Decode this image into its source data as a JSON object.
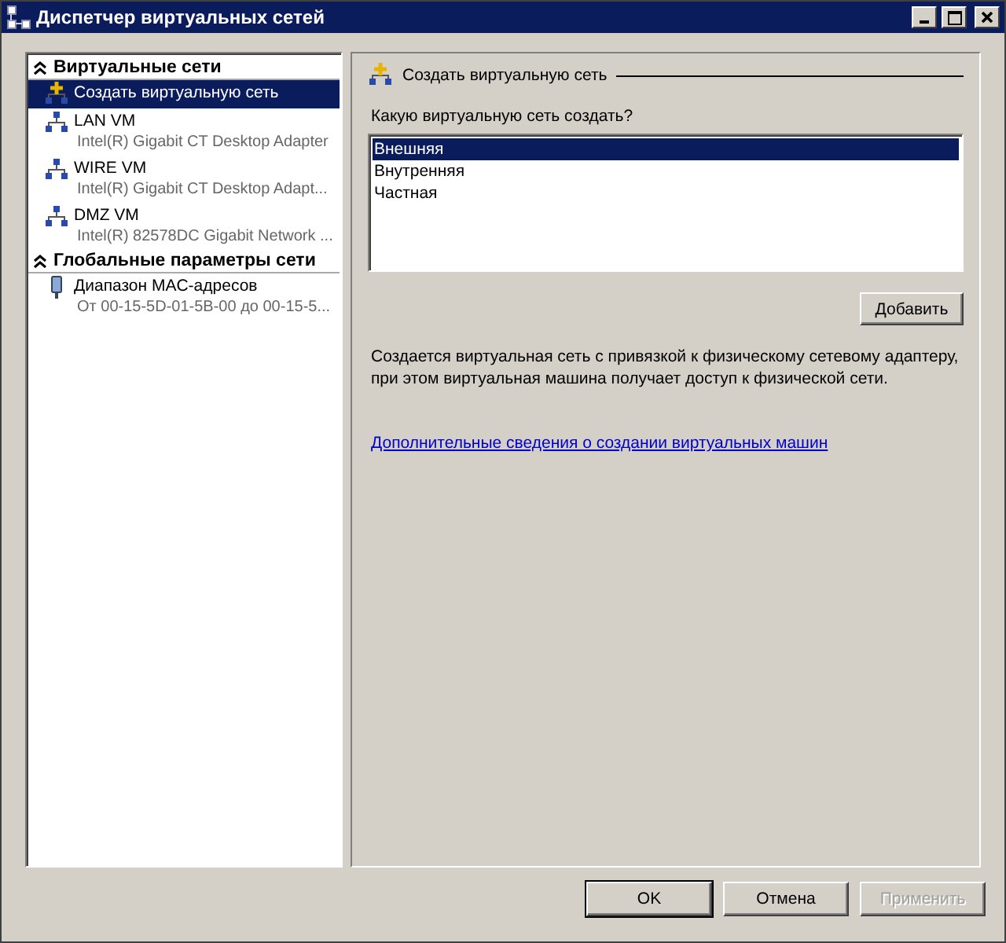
{
  "window": {
    "title": "Диспетчер виртуальных сетей"
  },
  "sidebar": {
    "sections": [
      {
        "title": "Виртуальные сети",
        "expanded": true,
        "items": [
          {
            "kind": "new-network",
            "name": "Создать виртуальную сеть",
            "selected": true
          },
          {
            "kind": "network",
            "name": "LAN VM",
            "detail": "Intel(R) Gigabit CT Desktop Adapter",
            "selected": false
          },
          {
            "kind": "network",
            "name": "WIRE VM",
            "detail": "Intel(R) Gigabit CT Desktop Adapt...",
            "selected": false
          },
          {
            "kind": "network",
            "name": "DMZ VM",
            "detail": "Intel(R) 82578DC Gigabit Network ...",
            "selected": false
          }
        ]
      },
      {
        "title": "Глобальные параметры сети",
        "expanded": true,
        "items": [
          {
            "kind": "mac",
            "name": "Диапазон MAC-адресов",
            "detail": "От 00-15-5D-01-5B-00 до 00-15-5...",
            "selected": false
          }
        ]
      }
    ]
  },
  "panel": {
    "title": "Создать виртуальную сеть",
    "question": "Какую виртуальную сеть создать?",
    "options": [
      {
        "label": "Внешняя",
        "selected": true
      },
      {
        "label": "Внутренняя",
        "selected": false
      },
      {
        "label": "Частная",
        "selected": false
      }
    ],
    "add_button": "Добавить",
    "description": "Создается виртуальная сеть с привязкой к физическому сетевому адаптеру, при этом виртуальная машина получает доступ к физической сети.",
    "link": "Дополнительные сведения о создании виртуальных машин"
  },
  "buttons": [
    {
      "label": "OK",
      "disabled": false,
      "default": true
    },
    {
      "label": "Отмена",
      "disabled": false,
      "default": false
    },
    {
      "label": "Применить",
      "disabled": true,
      "default": false
    }
  ]
}
